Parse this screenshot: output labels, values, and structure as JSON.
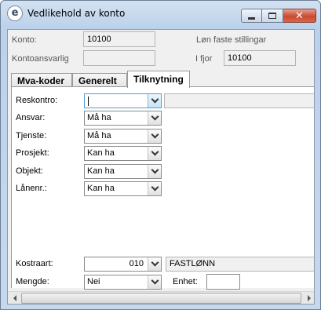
{
  "window": {
    "title": "Vedlikehold av konto",
    "icon_letter": "e"
  },
  "header": {
    "konto_label": "Konto:",
    "konto_value": "10100",
    "konto_name": "Løn faste stillingar",
    "kontoansvarlig_label": "Kontoansvarlig",
    "kontoansvarlig_value": "",
    "ifjor_label": "I fjor",
    "ifjor_value": "10100"
  },
  "tabs": [
    {
      "label": "Mva-koder",
      "active": false
    },
    {
      "label": "Generelt",
      "active": false
    },
    {
      "label": "Tilknytning",
      "active": true
    }
  ],
  "tilknytning": {
    "fields": [
      {
        "label": "Reskontro:",
        "value": ""
      },
      {
        "label": "Ansvar:",
        "value": "Må ha"
      },
      {
        "label": "Tjenste:",
        "value": "Må ha"
      },
      {
        "label": "Prosjekt:",
        "value": "Kan ha"
      },
      {
        "label": "Objekt:",
        "value": "Kan ha"
      },
      {
        "label": "Lånenr.:",
        "value": "Kan ha"
      }
    ]
  },
  "footer": {
    "kostraart_label": "Kostraart:",
    "kostraart_value": "010",
    "kostraart_name": "FASTLØNN",
    "mengde_label": "Mengde:",
    "mengde_value": "Nei",
    "enhet_label": "Enhet:",
    "enhet_value": ""
  },
  "icons": {
    "app": "app-e-icon",
    "minimize": "minimize-icon",
    "maximize": "maximize-icon",
    "close": "close-icon",
    "dropdown": "chevron-down-icon"
  }
}
